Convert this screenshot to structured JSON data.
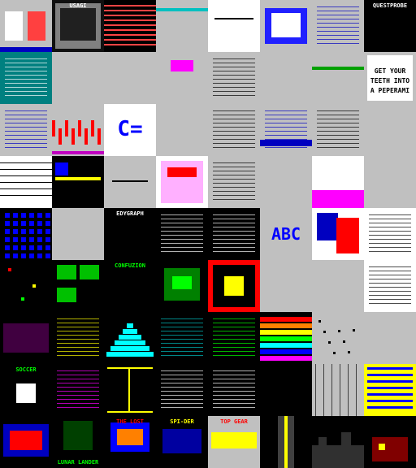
{
  "grid": {
    "columns": 8,
    "rows": 8,
    "tiles": [
      {
        "bg": "#c0c0c0",
        "fg": "#000000",
        "label": "",
        "theme": "figures"
      },
      {
        "bg": "#101010",
        "fg": "#ffffff",
        "label": "USAGI",
        "theme": "bw-art"
      },
      {
        "bg": "#000000",
        "fg": "#ff4444",
        "label": "",
        "theme": "stripes-red"
      },
      {
        "bg": "#c0c0c0",
        "fg": "#00c0c0",
        "label": "",
        "theme": "cyan-bar"
      },
      {
        "bg": "#ffffff",
        "fg": "#000000",
        "label": "",
        "theme": "white-line"
      },
      {
        "bg": "#c0c0c0",
        "fg": "#ffffff",
        "label": "",
        "theme": "blue-figures"
      },
      {
        "bg": "#c0c0c0",
        "fg": "#0000c0",
        "label": "",
        "theme": "text-blue"
      },
      {
        "bg": "#000000",
        "fg": "#ffffff",
        "label": "QUESTPROBE",
        "theme": "title"
      },
      {
        "bg": "#008080",
        "fg": "#ffffff",
        "label": "",
        "theme": "teal-text"
      },
      {
        "bg": "#c0c0c0",
        "fg": "#000000",
        "label": "",
        "theme": "blank"
      },
      {
        "bg": "#c0c0c0",
        "fg": "#000000",
        "label": "",
        "theme": "blank"
      },
      {
        "bg": "#c0c0c0",
        "fg": "#ff00ff",
        "label": "",
        "theme": "pink-box"
      },
      {
        "bg": "#c0c0c0",
        "fg": "#000000",
        "label": "",
        "theme": "text-dark"
      },
      {
        "bg": "#c0c0c0",
        "fg": "#000000",
        "label": "",
        "theme": "blank"
      },
      {
        "bg": "#c0c0c0",
        "fg": "#000000",
        "label": "",
        "theme": "green-top"
      },
      {
        "bg": "#c0c0c0",
        "fg": "#000000",
        "label": "GET YOUR TEETH INTO A PEPERAMI",
        "theme": "poster"
      },
      {
        "bg": "#c0c0c0",
        "fg": "#0000c0",
        "label": "",
        "theme": "text-blue"
      },
      {
        "bg": "#c0c0c0",
        "fg": "#ff0000",
        "label": "",
        "theme": "red-wave"
      },
      {
        "bg": "#ffffff",
        "fg": "#0000ff",
        "label": "C=",
        "theme": "commodore"
      },
      {
        "bg": "#c0c0c0",
        "fg": "#000000",
        "label": "",
        "theme": "blank"
      },
      {
        "bg": "#c0c0c0",
        "fg": "#000000",
        "label": "",
        "theme": "text-dark"
      },
      {
        "bg": "#c0c0c0",
        "fg": "#0000c0",
        "label": "",
        "theme": "blue-table"
      },
      {
        "bg": "#c0c0c0",
        "fg": "#000000",
        "label": "",
        "theme": "text-dark"
      },
      {
        "bg": "#c0c0c0",
        "fg": "#000000",
        "label": "",
        "theme": "blank"
      },
      {
        "bg": "#ffffff",
        "fg": "#000000",
        "label": "",
        "theme": "white-lines"
      },
      {
        "bg": "#000000",
        "fg": "#ffff00",
        "label": "",
        "theme": "yellow-block"
      },
      {
        "bg": "#c0c0c0",
        "fg": "#000000",
        "label": "",
        "theme": "ramp"
      },
      {
        "bg": "#ffffff",
        "fg": "#ff00ff",
        "label": "",
        "theme": "colorful"
      },
      {
        "bg": "#c0c0c0",
        "fg": "#000000",
        "label": "",
        "theme": "text-dark"
      },
      {
        "bg": "#c0c0c0",
        "fg": "#000000",
        "label": "",
        "theme": "blank"
      },
      {
        "bg": "#ffffff",
        "fg": "#ff00ff",
        "label": "",
        "theme": "pink-skyline"
      },
      {
        "bg": "#c0c0c0",
        "fg": "#000000",
        "label": "",
        "theme": "blank"
      },
      {
        "bg": "#000000",
        "fg": "#0000ff",
        "label": "",
        "theme": "blue-grid"
      },
      {
        "bg": "#c0c0c0",
        "fg": "#000000",
        "label": "",
        "theme": "blank"
      },
      {
        "bg": "#000000",
        "fg": "#ffffff",
        "label": "EDYGRAPH",
        "theme": "title"
      },
      {
        "bg": "#000000",
        "fg": "#ffffff",
        "label": "",
        "theme": "text-white"
      },
      {
        "bg": "#000000",
        "fg": "#ffffff",
        "label": "",
        "theme": "text-white"
      },
      {
        "bg": "#c0c0c0",
        "fg": "#0000ff",
        "label": "ABC",
        "theme": "big-text"
      },
      {
        "bg": "#ffffff",
        "fg": "#ff0000",
        "label": "",
        "theme": "cartoon"
      },
      {
        "bg": "#ffffff",
        "fg": "#000000",
        "label": "",
        "theme": "text-dark"
      },
      {
        "bg": "#000000",
        "fg": "#ff0000",
        "label": "",
        "theme": "dots"
      },
      {
        "bg": "#000000",
        "fg": "#00c000",
        "label": "",
        "theme": "green-panels"
      },
      {
        "bg": "#000000",
        "fg": "#00ff00",
        "label": "CONFUZION",
        "theme": "title-green"
      },
      {
        "bg": "#000000",
        "fg": "#00ff00",
        "label": "",
        "theme": "green-art"
      },
      {
        "bg": "#000000",
        "fg": "#ff0000",
        "label": "",
        "theme": "red-frame"
      },
      {
        "bg": "#c0c0c0",
        "fg": "#000000",
        "label": "",
        "theme": "blank"
      },
      {
        "bg": "#c0c0c0",
        "fg": "#000000",
        "label": "",
        "theme": "blank"
      },
      {
        "bg": "#ffffff",
        "fg": "#000000",
        "label": "",
        "theme": "text-dark"
      },
      {
        "bg": "#000000",
        "fg": "#ff0000",
        "label": "",
        "theme": "people"
      },
      {
        "bg": "#000000",
        "fg": "#ffff00",
        "label": "",
        "theme": "text-yellow"
      },
      {
        "bg": "#000000",
        "fg": "#00ffff",
        "label": "",
        "theme": "pyramid"
      },
      {
        "bg": "#000000",
        "fg": "#00c0c0",
        "label": "",
        "theme": "text-cyan"
      },
      {
        "bg": "#000000",
        "fg": "#00ff00",
        "label": "",
        "theme": "text-green"
      },
      {
        "bg": "#000000",
        "fg": "#ffffff",
        "label": "",
        "theme": "rainbow"
      },
      {
        "bg": "#c0c0c0",
        "fg": "#000000",
        "label": "",
        "theme": "scatter"
      },
      {
        "bg": "#c0c0c0",
        "fg": "#000000",
        "label": "",
        "theme": "blank"
      },
      {
        "bg": "#000000",
        "fg": "#00ff00",
        "label": "SOCCER",
        "theme": "soccer"
      },
      {
        "bg": "#000000",
        "fg": "#ff00ff",
        "label": "",
        "theme": "text-magenta"
      },
      {
        "bg": "#000000",
        "fg": "#ffff00",
        "label": "",
        "theme": "maze"
      },
      {
        "bg": "#000000",
        "fg": "#ffffff",
        "label": "",
        "theme": "text-white"
      },
      {
        "bg": "#000000",
        "fg": "#ffffff",
        "label": "",
        "theme": "text-white"
      },
      {
        "bg": "#000000",
        "fg": "#ffffff",
        "label": "",
        "theme": "blank-dark"
      },
      {
        "bg": "#c0c0c0",
        "fg": "#000000",
        "label": "",
        "theme": "grid-lines"
      },
      {
        "bg": "#ffff00",
        "fg": "#0000ff",
        "label": "",
        "theme": "maze-blue"
      },
      {
        "bg": "#000000",
        "fg": "#ff0000",
        "label": "",
        "theme": "game-red"
      },
      {
        "bg": "#000000",
        "fg": "#00ff00",
        "label": "LUNAR LANDER",
        "theme": "game-green"
      },
      {
        "bg": "#000000",
        "fg": "#ff0000",
        "label": "THE LOST",
        "theme": "game-colorful"
      },
      {
        "bg": "#000000",
        "fg": "#ffff00",
        "label": "SPI-DER",
        "theme": "game-yellow"
      },
      {
        "bg": "#c0c0c0",
        "fg": "#ff0000",
        "label": "TOP GEAR",
        "theme": "topgear"
      },
      {
        "bg": "#000000",
        "fg": "#ffff00",
        "label": "",
        "theme": "road"
      },
      {
        "bg": "#000000",
        "fg": "#00c0ff",
        "label": "",
        "theme": "city"
      },
      {
        "bg": "#000000",
        "fg": "#ff0000",
        "label": "",
        "theme": "house"
      }
    ]
  }
}
